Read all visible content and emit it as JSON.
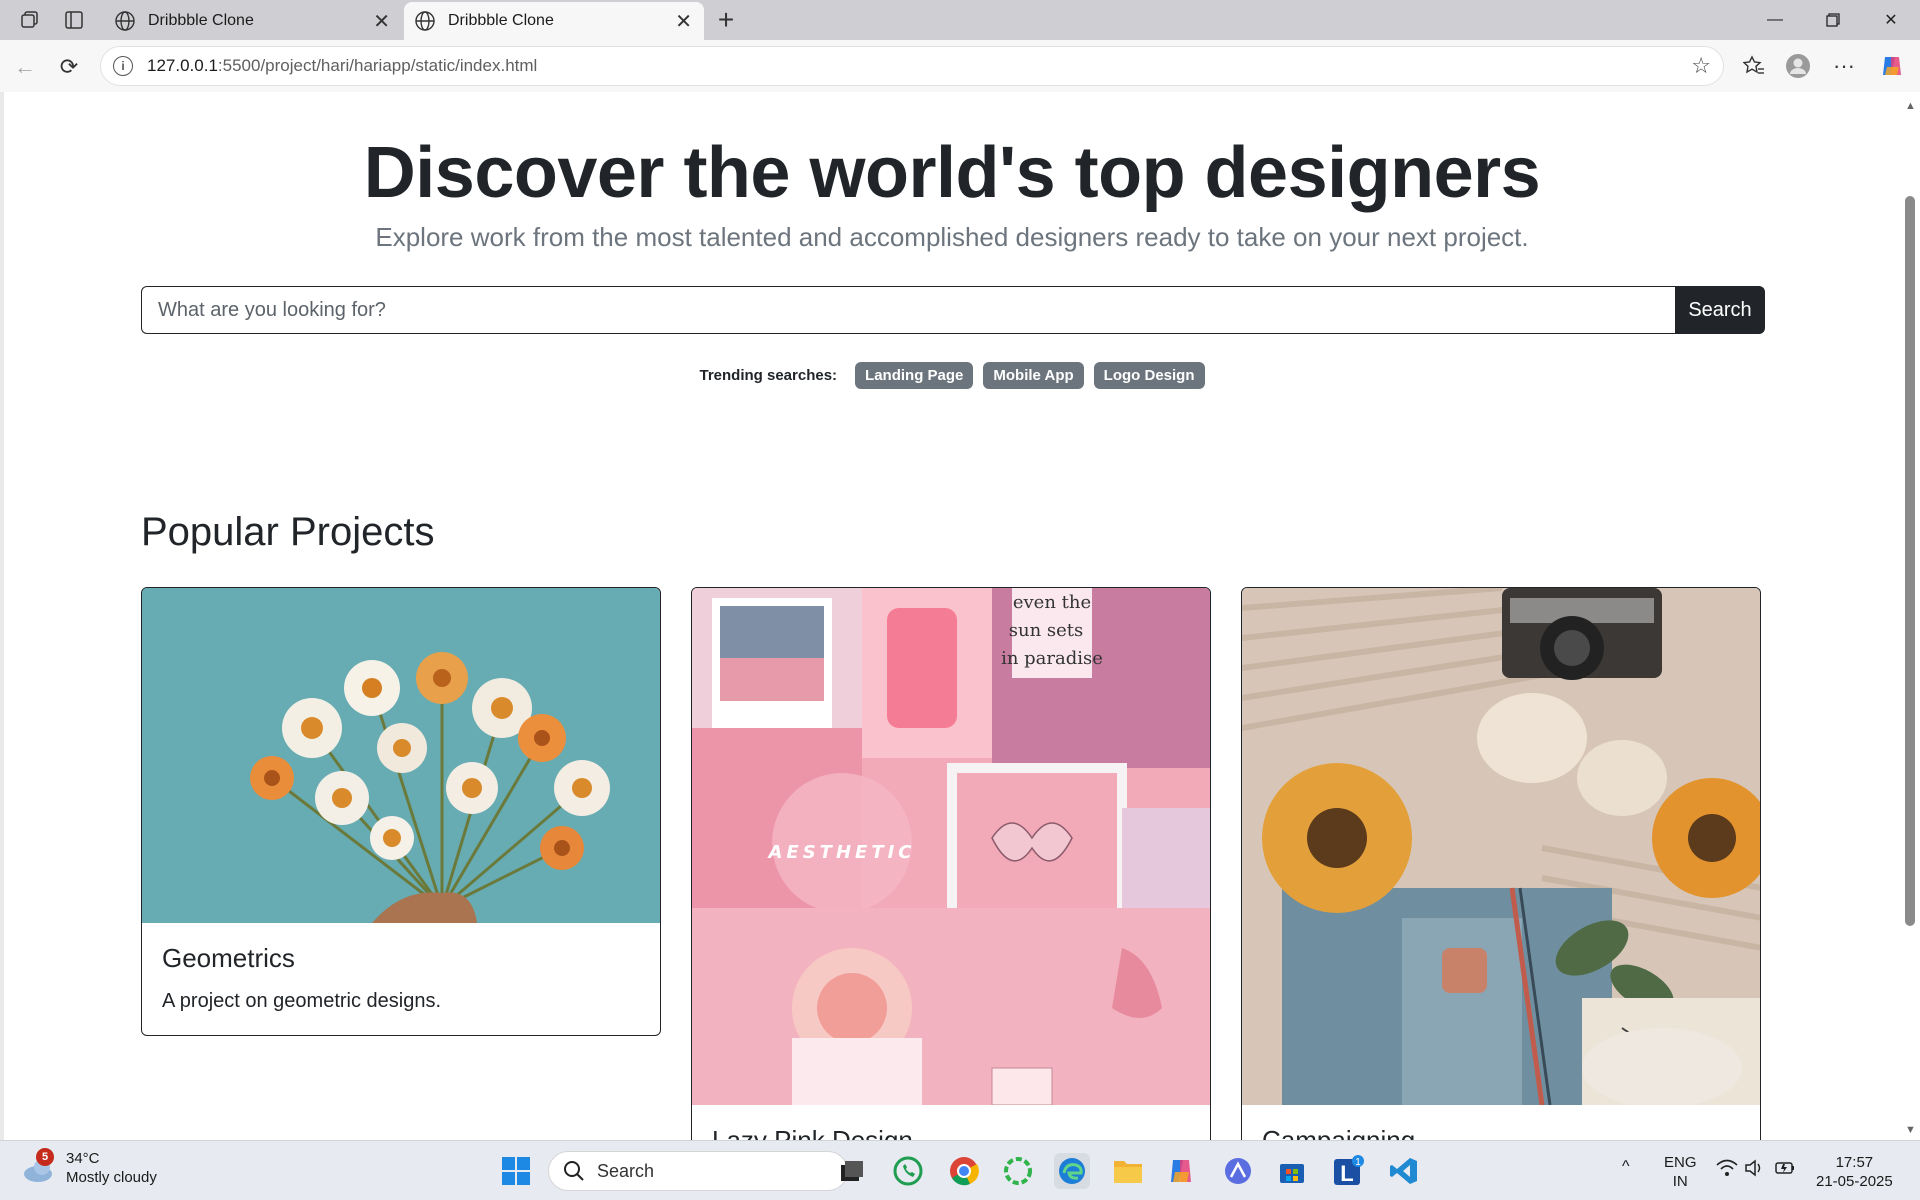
{
  "browser": {
    "tabs": [
      {
        "label": "Dribbble Clone"
      },
      {
        "label": "Dribbble Clone"
      }
    ],
    "url_host": "127.0.0.1",
    "url_rest": ":5500/project/hari/hariapp/static/index.html"
  },
  "hero": {
    "title": "Discover the world's top designers",
    "subtitle": "Explore work from the most talented and accomplished designers ready to take on your next project."
  },
  "search": {
    "placeholder": "What are you looking for?",
    "button_label": "Search"
  },
  "trending": {
    "label": "Trending searches:",
    "tags": [
      "Landing Page",
      "Mobile App",
      "Logo Design"
    ]
  },
  "projects": {
    "section_title": "Popular Projects",
    "cards": [
      {
        "title": "Geometrics",
        "description": "A project on geometric designs."
      },
      {
        "title": "Lazy Pink Design",
        "description": ""
      },
      {
        "title": "Campaigning",
        "description": ""
      }
    ]
  },
  "taskbar": {
    "weather_temp": "34°C",
    "weather_desc": "Mostly cloudy",
    "weather_badge": "5",
    "search_label": "Search",
    "lang_top": "ENG",
    "lang_bottom": "IN",
    "time": "17:57",
    "date": "21-05-2025"
  }
}
